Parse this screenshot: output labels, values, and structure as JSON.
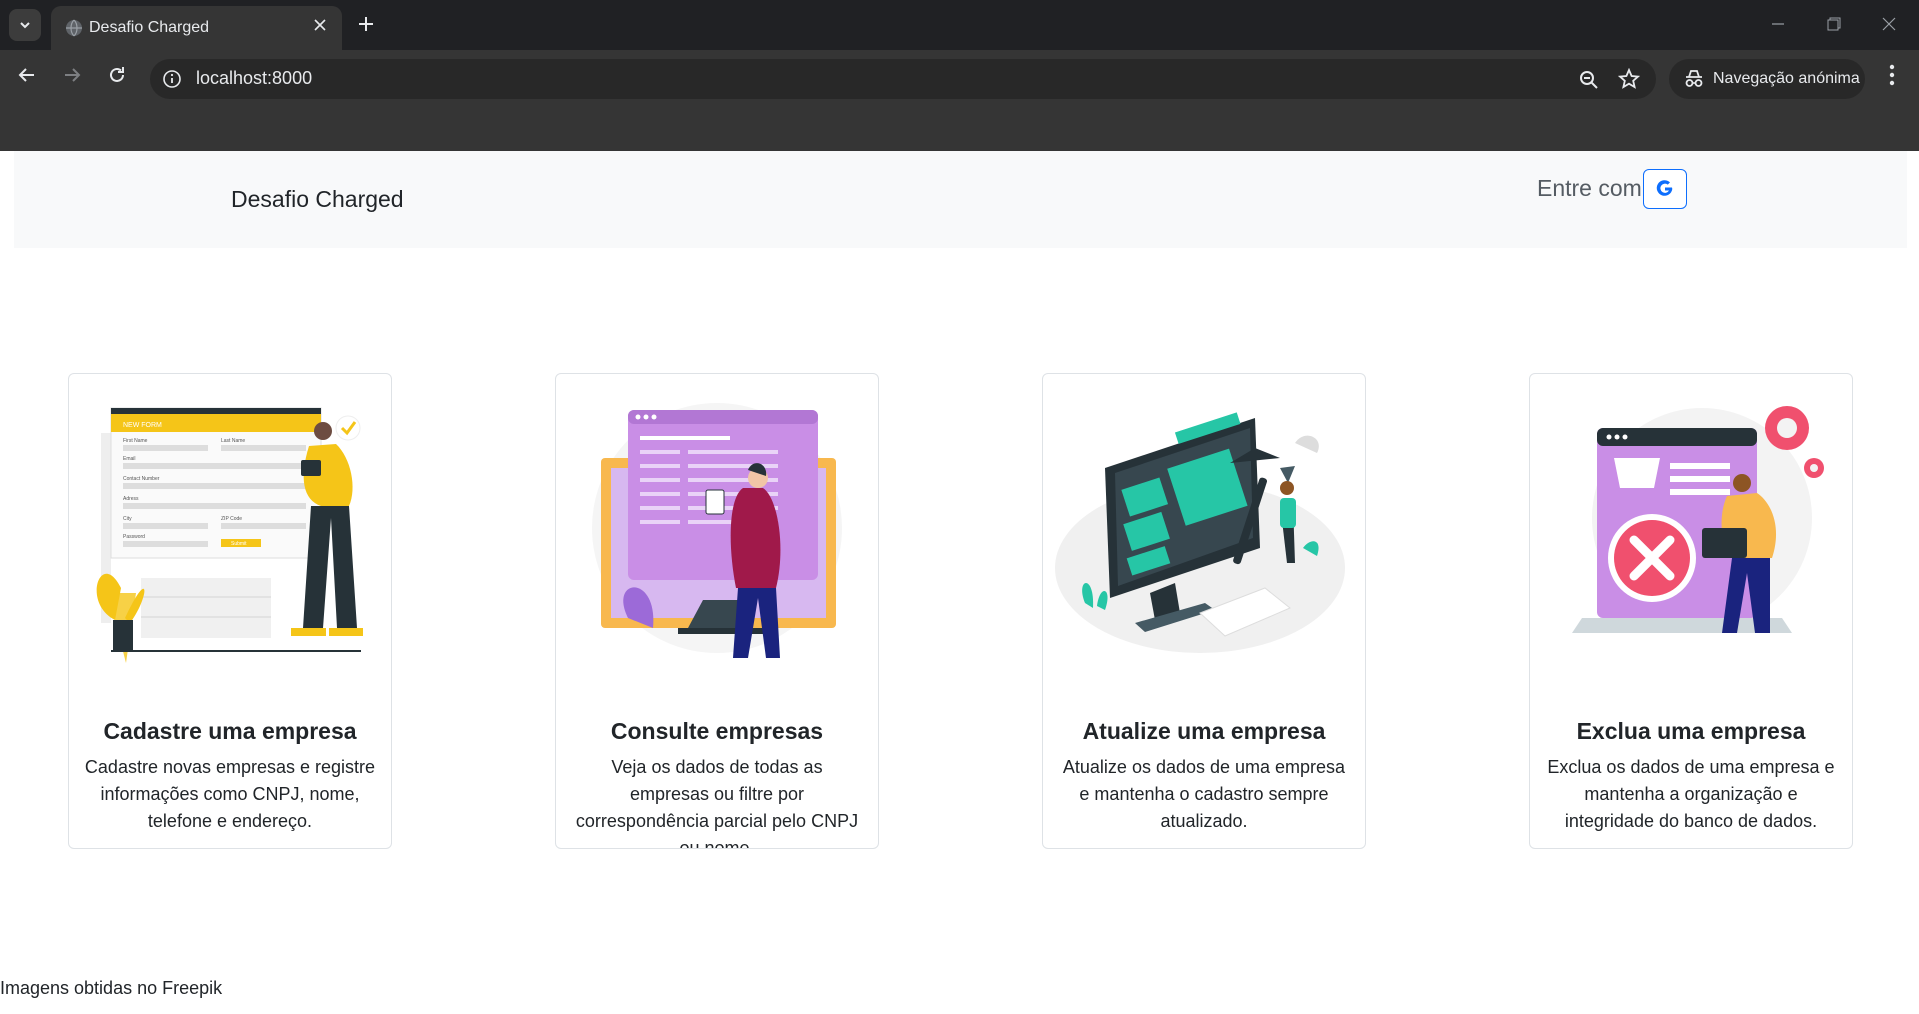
{
  "browser": {
    "tab_title": "Desafio Charged",
    "url": "localhost:8000",
    "incognito_label": "Navegação anónima",
    "icons": [
      "tab-search-icon",
      "globe-icon",
      "close-icon",
      "plus-icon",
      "minimize-icon",
      "restore-icon",
      "window-close-icon",
      "back-icon",
      "forward-icon",
      "reload-icon",
      "info-icon",
      "zoom-icon",
      "star-icon",
      "incognito-icon",
      "kebab-menu-icon"
    ]
  },
  "header": {
    "brand": "Desafio Charged",
    "login_label": "Entre com",
    "login_icon": "google-icon"
  },
  "cards": [
    {
      "title": "Cadastre uma empresa",
      "text": "Cadastre novas empresas e registre informações como CNPJ, nome, telefone e endereço.",
      "illustration": "form-filling-illustration"
    },
    {
      "title": "Consulte empresas",
      "text": "Veja os dados de todas as empresas ou filtre por correspondência parcial pelo CNPJ ou nome.",
      "illustration": "browsing-data-illustration"
    },
    {
      "title": "Atualize uma empresa",
      "text": "Atualize os dados de uma empresa e mantenha o cadastro sempre atualizado.",
      "illustration": "editing-monitor-illustration"
    },
    {
      "title": "Exclua uma empresa",
      "text": "Exclua os dados de uma empresa e mantenha a organização e integridade do banco de dados.",
      "illustration": "delete-data-illustration"
    }
  ],
  "form_illustration_labels": {
    "banner": "NEW FORM",
    "first_name": "First Name",
    "last_name": "Last Name",
    "email": "Email",
    "contact": "Contact Number",
    "address": "Adress",
    "city": "City",
    "zip": "ZIP Code",
    "password": "Password",
    "submit": "Submit"
  },
  "footer": {
    "note": "Imagens obtidas no Freepik"
  },
  "colors": {
    "accent": "#0d6efd",
    "form_yellow": "#f5c518",
    "teal": "#26c6a6",
    "purple": "#c98ee6",
    "red": "#f0506e",
    "orange": "#f8b84e"
  }
}
